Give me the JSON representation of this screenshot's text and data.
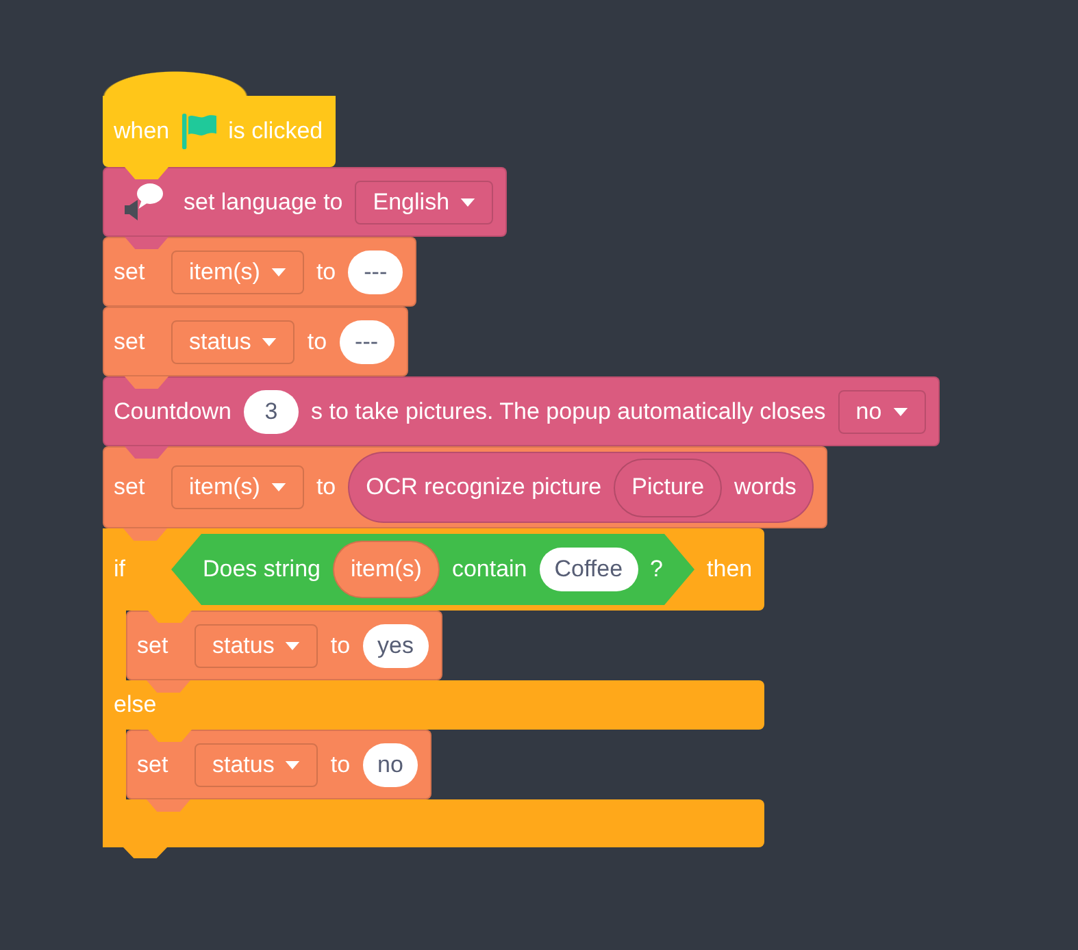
{
  "script": {
    "blocks": [
      {
        "kind": "hat",
        "color": "#ffc619",
        "parts": [
          {
            "kind": "label",
            "text": "when"
          },
          {
            "kind": "icon"
          },
          {
            "kind": "label",
            "text": "is clicked"
          }
        ]
      },
      {
        "kind": "command",
        "color": "#da5b7f",
        "parts": [
          {
            "kind": "icon"
          },
          {
            "kind": "label",
            "text": "set language to"
          },
          {
            "kind": "dropdown",
            "value": "English"
          }
        ]
      },
      {
        "kind": "command",
        "color": "#f8865a",
        "parts": [
          {
            "kind": "label",
            "text": "set"
          },
          {
            "kind": "dropdown",
            "value": "item(s)"
          },
          {
            "kind": "label",
            "text": "to"
          },
          {
            "kind": "input",
            "value": "---"
          }
        ]
      },
      {
        "kind": "command",
        "color": "#f8865a",
        "parts": [
          {
            "kind": "label",
            "text": "set"
          },
          {
            "kind": "dropdown",
            "value": "status"
          },
          {
            "kind": "label",
            "text": "to"
          },
          {
            "kind": "input",
            "value": "---"
          }
        ]
      },
      {
        "kind": "command",
        "color": "#da5b7f",
        "parts": [
          {
            "kind": "label",
            "text": "Countdown"
          },
          {
            "kind": "input",
            "value": "3"
          },
          {
            "kind": "label",
            "text": "s to take pictures. The popup automatically closes"
          },
          {
            "kind": "dropdown",
            "value": "no"
          }
        ]
      },
      {
        "kind": "command",
        "color": "#f8865a",
        "parts": [
          {
            "kind": "label",
            "text": "set"
          },
          {
            "kind": "dropdown",
            "value": "item(s)"
          },
          {
            "kind": "label",
            "text": "to"
          },
          {
            "kind": "reporter",
            "color": "#da5b7f",
            "parts": [
              {
                "kind": "label",
                "text": "OCR recognize picture"
              },
              {
                "kind": "menu",
                "value": "Picture"
              },
              {
                "kind": "label",
                "text": "words"
              }
            ]
          }
        ]
      },
      {
        "kind": "if-else",
        "color": "#ffa81a",
        "parts": [
          {
            "kind": "label",
            "text": "if"
          },
          {
            "kind": "boolean",
            "color": "#40bd4a",
            "parts": [
              {
                "kind": "label",
                "text": "Does string"
              },
              {
                "kind": "reporter",
                "color": "#f8865a",
                "parts": [
                  {
                    "kind": "label",
                    "text": "item(s)"
                  }
                ]
              },
              {
                "kind": "label",
                "text": "contain"
              },
              {
                "kind": "input",
                "value": "Coffee"
              },
              {
                "kind": "label",
                "text": "?"
              }
            ]
          },
          {
            "kind": "label",
            "text": "then"
          }
        ],
        "then": [
          {
            "kind": "command",
            "color": "#f8865a",
            "parts": [
              {
                "kind": "label",
                "text": "set"
              },
              {
                "kind": "dropdown",
                "value": "status"
              },
              {
                "kind": "label",
                "text": "to"
              },
              {
                "kind": "input",
                "value": "yes"
              }
            ]
          }
        ],
        "else_label": "else",
        "else": [
          {
            "kind": "command",
            "color": "#f8865a",
            "parts": [
              {
                "kind": "label",
                "text": "set"
              },
              {
                "kind": "dropdown",
                "value": "status"
              },
              {
                "kind": "label",
                "text": "to"
              },
              {
                "kind": "input",
                "value": "no"
              }
            ]
          }
        ]
      }
    ]
  }
}
